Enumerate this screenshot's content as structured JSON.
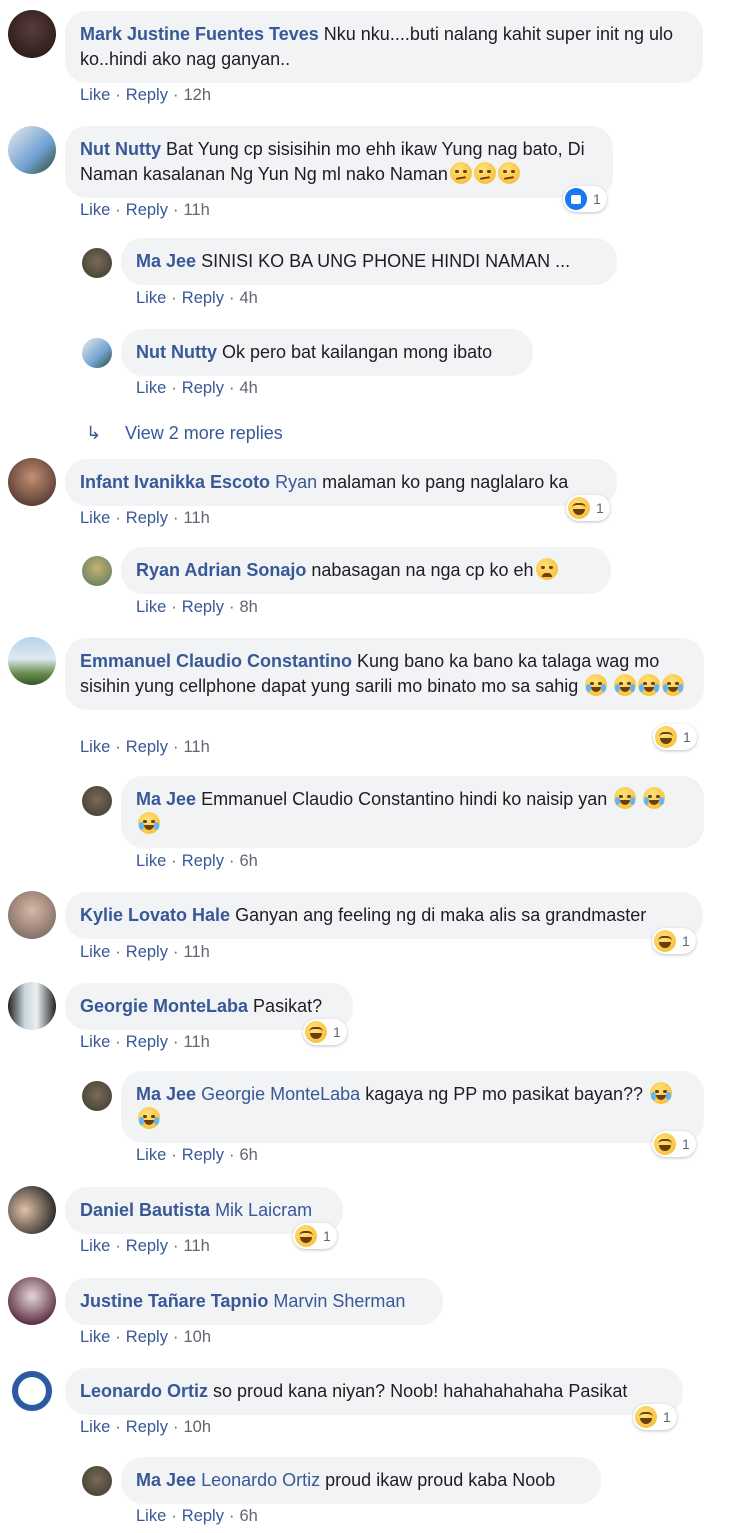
{
  "actions": {
    "like": "Like",
    "reply": "Reply",
    "sep": "·"
  },
  "view_more": "View 2 more replies",
  "comments": [
    {
      "author": "Mark Justine Fuentes Teves",
      "text": "Nku nku....buti nalang kahit super init ng ulo ko..hindi ako nag ganyan..",
      "time": "12h"
    },
    {
      "author": "Nut Nutty",
      "text": "Bat Yung cp sisisihin mo ehh ikaw Yung nag bato, Di Naman kasalanan Ng Yun Ng ml nako Naman",
      "time": "11h",
      "reaction_count": "1"
    },
    {
      "author": "Ma Jee",
      "text": "SINISI KO BA UNG PHONE HINDI NAMAN ...",
      "time": "4h"
    },
    {
      "author": "Nut Nutty",
      "text": "Ok pero bat kailangan mong ibato",
      "time": "4h"
    },
    {
      "author": "Infant Ivanikka Escoto",
      "mention": "Ryan",
      "text": "malaman ko pang naglalaro ka",
      "time": "11h",
      "reaction_count": "1"
    },
    {
      "author": "Ryan Adrian Sonajo",
      "text": "nabasagan na nga cp ko eh",
      "time": "8h"
    },
    {
      "author": "Emmanuel Claudio Constantino",
      "text": "Kung bano ka bano ka talaga wag mo sisihin yung cellphone dapat yung sarili mo binato mo sa sahig",
      "time": "11h",
      "reaction_count": "1"
    },
    {
      "author": "Ma Jee",
      "text": "Emmanuel Claudio Constantino hindi ko naisip yan",
      "time": "6h"
    },
    {
      "author": "Kylie Lovato Hale",
      "text": "Ganyan ang feeling ng di maka alis sa grandmaster",
      "time": "11h",
      "reaction_count": "1"
    },
    {
      "author": "Georgie MonteLaba",
      "text": "Pasikat?",
      "time": "11h",
      "reaction_count": "1"
    },
    {
      "author": "Ma Jee",
      "mention": "Georgie MonteLaba",
      "text": "kagaya ng PP mo pasikat bayan??",
      "time": "6h",
      "reaction_count": "1"
    },
    {
      "author": "Daniel Bautista",
      "mention": "Mik Laicram",
      "text": "",
      "time": "11h",
      "reaction_count": "1"
    },
    {
      "author": "Justine Tañare Tapnio",
      "mention": "Marvin Sherman",
      "text": "",
      "time": "10h"
    },
    {
      "author": "Leonardo Ortiz",
      "text": "so proud kana niyan? Noob! hahahahahaha Pasikat",
      "time": "10h",
      "reaction_count": "1"
    },
    {
      "author": "Ma Jee",
      "mention": "Leonardo Ortiz",
      "text": "proud ikaw proud kaba Noob",
      "time": "6h"
    }
  ]
}
